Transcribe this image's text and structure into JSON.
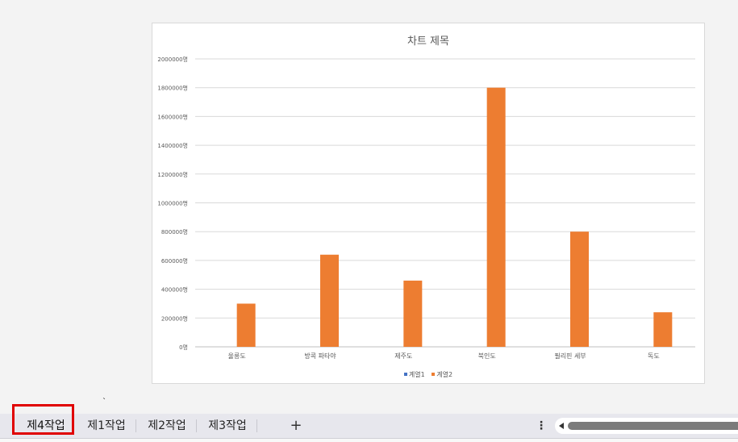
{
  "chart_data": {
    "type": "bar",
    "title": "차트 제목",
    "categories": [
      "울릉도",
      "방콕 파타야",
      "제주도",
      "북인도",
      "필리핀 세부",
      "독도"
    ],
    "series": [
      {
        "name": "계열1",
        "values": [
          0,
          0,
          0,
          0,
          0,
          0
        ],
        "color": "#4472c4"
      },
      {
        "name": "계열2",
        "values": [
          300000,
          640000,
          460000,
          1800000,
          800000,
          240000
        ],
        "color": "#ed7d31"
      }
    ],
    "y_ticks": [
      "0명",
      "200000명",
      "400000명",
      "600000명",
      "800000명",
      "1000000명",
      "1200000명",
      "1400000명",
      "1600000명",
      "1800000명",
      "2000000명"
    ],
    "ylim": [
      0,
      2000000
    ],
    "xlabel": "",
    "ylabel": "",
    "grid": true,
    "legend_position": "bottom"
  },
  "sheet_tabs": [
    {
      "label": "제4작업",
      "active": true
    },
    {
      "label": "제1작업",
      "active": false
    },
    {
      "label": "제2작업",
      "active": false
    },
    {
      "label": "제3작업",
      "active": false
    }
  ],
  "cell_mark": "`",
  "add_sheet_label": "+",
  "more_options_label": "⋮",
  "colors": {
    "highlight_border": "#e00000",
    "active_tab_underline": "#1e6b3a",
    "series_1": "#4472c4",
    "series_2": "#ed7d31"
  }
}
